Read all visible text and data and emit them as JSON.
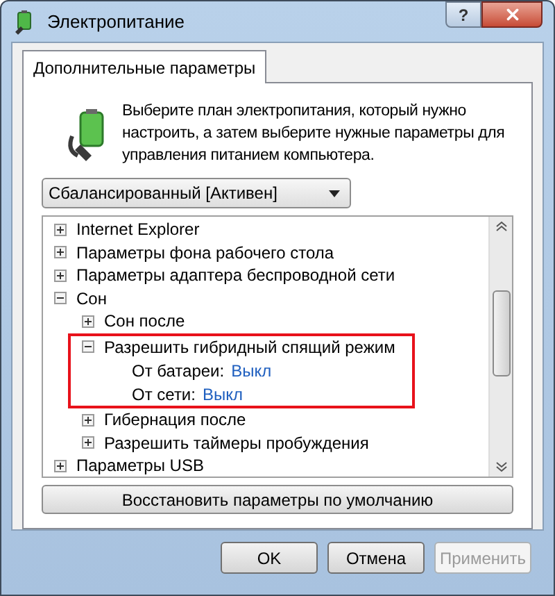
{
  "window": {
    "title": "Электропитание",
    "help_button": "?"
  },
  "tabs": [
    {
      "label": "Дополнительные параметры",
      "selected": true
    }
  ],
  "intro": "Выберите план электропитания, который нужно настроить, а затем выберите нужные параметры для управления питанием компьютера.",
  "plan_dropdown": {
    "value": "Сбалансированный [Активен]"
  },
  "tree": [
    {
      "label": "Internet Explorer",
      "expanded": false
    },
    {
      "label": "Параметры фона рабочего стола",
      "expanded": false
    },
    {
      "label": "Параметры адаптера беспроводной сети",
      "expanded": false
    },
    {
      "label": "Сон",
      "expanded": true,
      "children": [
        {
          "label": "Сон после",
          "expanded": false
        },
        {
          "label": "Разрешить гибридный спящий режим",
          "expanded": true,
          "highlighted": true,
          "settings": [
            {
              "label": "От батареи:",
              "value": "Выкл"
            },
            {
              "label": "От сети:",
              "value": "Выкл"
            }
          ]
        },
        {
          "label": "Гибернация после",
          "expanded": false
        },
        {
          "label": "Разрешить таймеры пробуждения",
          "expanded": false
        }
      ]
    },
    {
      "label": "Параметры USB",
      "expanded": false
    }
  ],
  "restore_button": "Восстановить параметры по умолчанию",
  "buttons": [
    {
      "label": "OK",
      "disabled": false
    },
    {
      "label": "Отмена",
      "disabled": false
    },
    {
      "label": "Применить",
      "disabled": true
    }
  ]
}
